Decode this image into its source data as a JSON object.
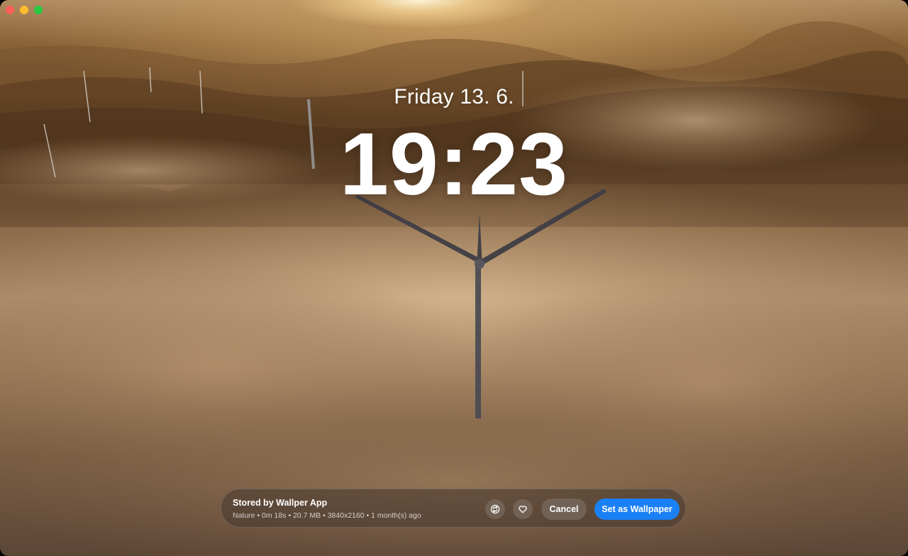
{
  "window": {
    "controls": [
      "close",
      "minimize",
      "maximize"
    ]
  },
  "lockscreen": {
    "date": "Friday 13. 6.",
    "time": "19:23"
  },
  "info_bar": {
    "title": "Stored by Wallper App",
    "meta": "Nature • 0m 18s • 20.7 MB • 3840x2160 • 1 month(s) ago",
    "cancel_label": "Cancel",
    "set_label": "Set as Wallpaper"
  },
  "colors": {
    "accent": "#1a80f5",
    "close": "#ff5f57",
    "minimize": "#febc2e",
    "maximize": "#28c840"
  },
  "icons": [
    "repeat-icon",
    "heart-icon"
  ]
}
